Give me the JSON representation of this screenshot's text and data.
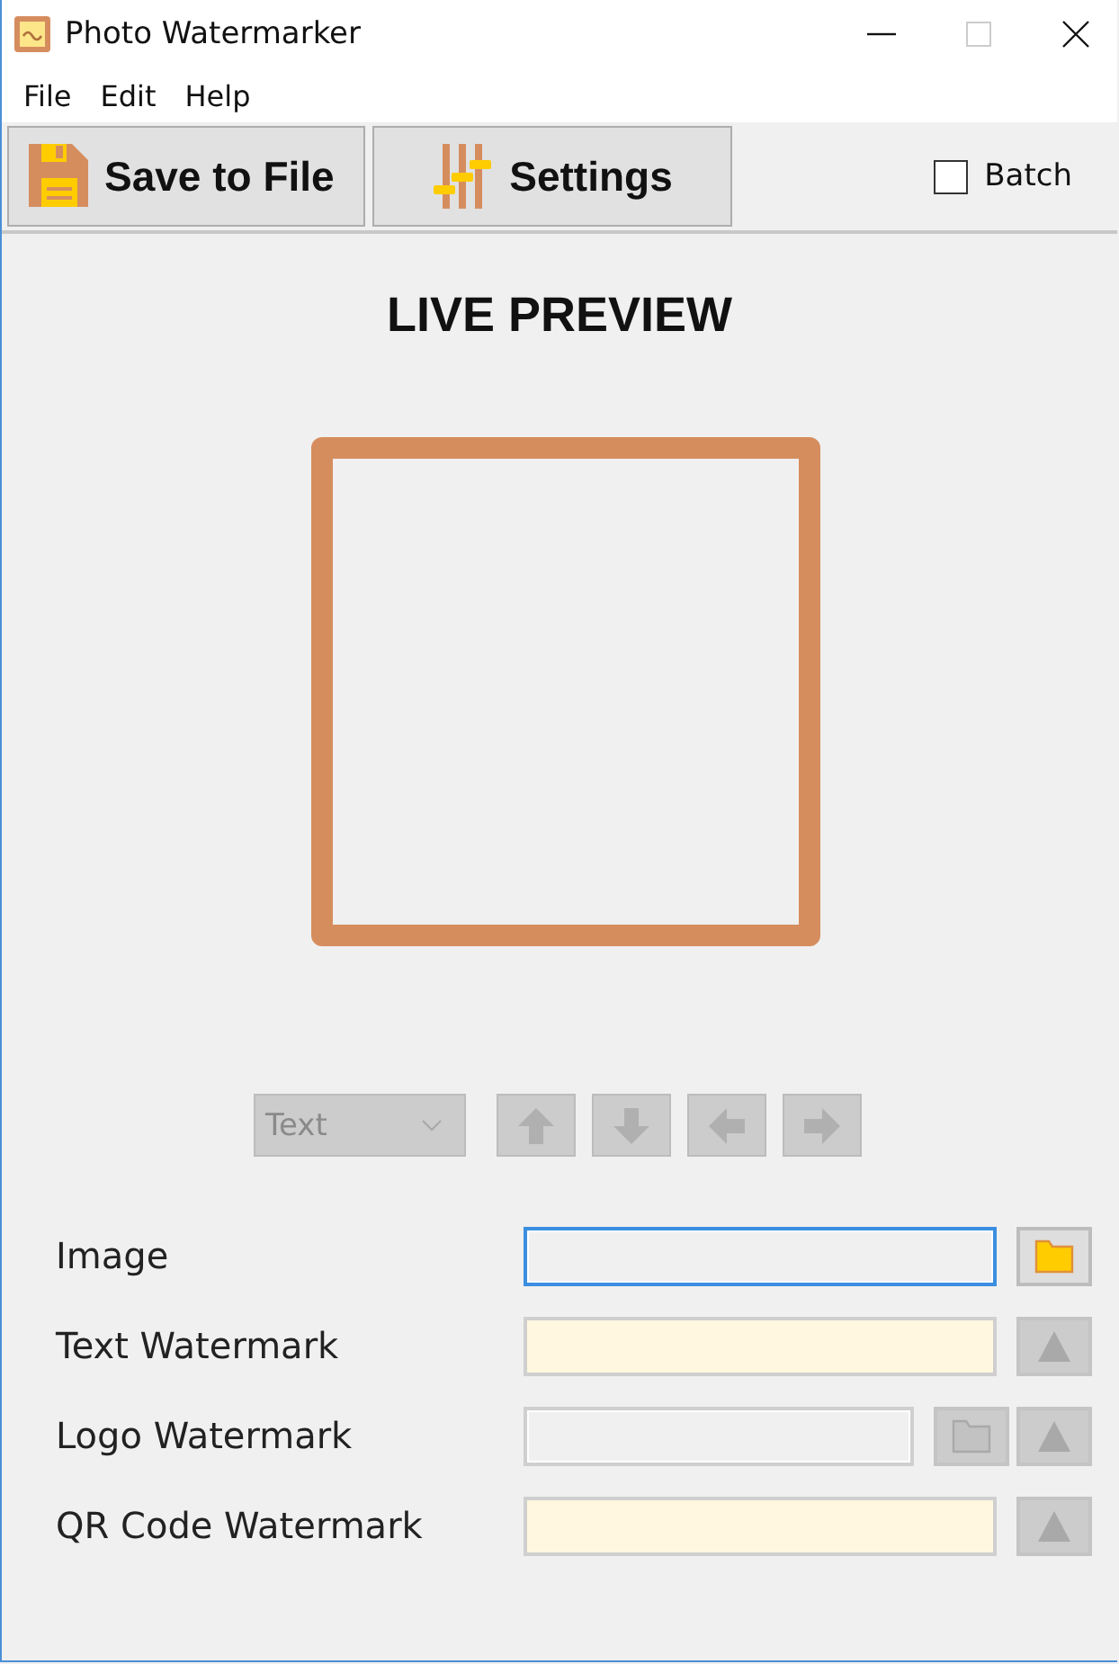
{
  "window": {
    "title": "Photo Watermarker"
  },
  "menu": [
    "File",
    "Edit",
    "Help"
  ],
  "toolbar": [
    {
      "label": "Save to File",
      "kind": "save"
    },
    {
      "label": "Settings",
      "kind": "settings"
    }
  ],
  "batch": {
    "label": "Batch",
    "checked": false
  },
  "preview": {
    "title": "LIVE PREVIEW"
  },
  "layer_select": {
    "value": "Text",
    "disabled": true
  },
  "arrows": [
    {
      "kind": "up",
      "disabled": true
    },
    {
      "kind": "down",
      "disabled": true
    },
    {
      "kind": "left",
      "disabled": true
    },
    {
      "kind": "right",
      "disabled": true
    }
  ],
  "fields": [
    {
      "label": "Image",
      "kind": "plain",
      "focused": true,
      "buttons": [
        {
          "kind": "folder",
          "disabled": false
        }
      ]
    },
    {
      "label": "Text Watermark",
      "kind": "highlight",
      "focused": false,
      "buttons": [
        {
          "kind": "triangle",
          "disabled": true
        }
      ]
    },
    {
      "label": "Logo Watermark",
      "kind": "plain",
      "focused": false,
      "buttons": [
        {
          "kind": "folder",
          "disabled": true
        },
        {
          "kind": "triangle",
          "disabled": true
        }
      ]
    },
    {
      "label": "QR Code Watermark",
      "kind": "highlight",
      "focused": false,
      "buttons": [
        {
          "kind": "triangle",
          "disabled": true
        }
      ]
    }
  ]
}
